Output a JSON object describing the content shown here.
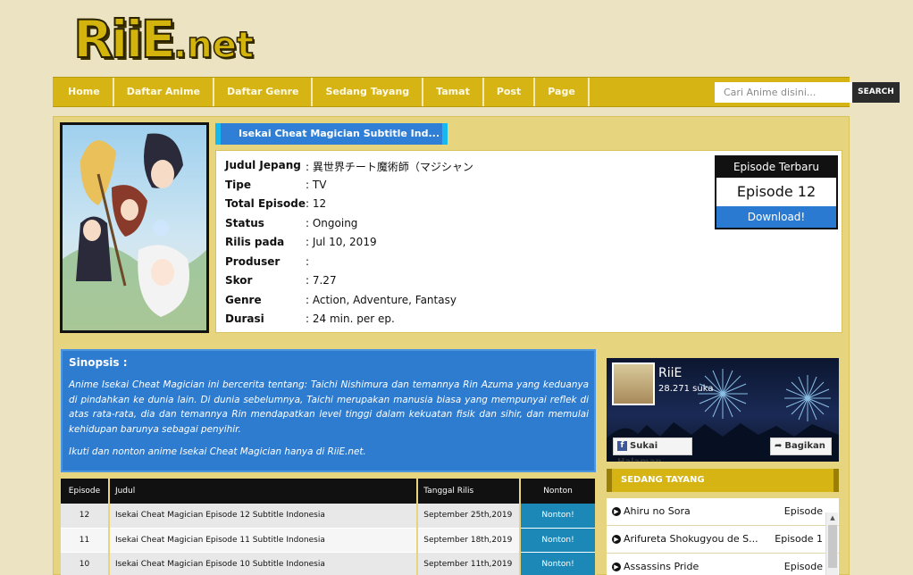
{
  "logo": {
    "main": "RiiE",
    "suffix": ".net"
  },
  "nav": {
    "items": [
      "Home",
      "Daftar Anime",
      "Daftar Genre",
      "Sedang Tayang",
      "Tamat",
      "Post",
      "Page"
    ],
    "search_placeholder": "Cari Anime disini...",
    "search_button": "SEARCH"
  },
  "anime": {
    "title": "Isekai Cheat Magician Subtitle Ind...",
    "info": [
      {
        "label": "Judul Jepang",
        "value": ": 異世界チート魔術師（マジシャン"
      },
      {
        "label": "Tipe",
        "value": ": TV"
      },
      {
        "label": "Total Episode",
        "value": ": 12"
      },
      {
        "label": "Status",
        "value": ": Ongoing"
      },
      {
        "label": "Rilis pada",
        "value": ": Jul 10, 2019"
      },
      {
        "label": "Produser",
        "value": ":"
      },
      {
        "label": "Skor",
        "value": ": 7.27"
      },
      {
        "label": "Genre",
        "value": ": Action, Adventure, Fantasy"
      },
      {
        "label": "Durasi",
        "value": ": 24 min. per ep."
      }
    ]
  },
  "latest_episode": {
    "heading": "Episode Terbaru",
    "episode": "Episode 12",
    "download": "Download!"
  },
  "sinopsis": {
    "title": "Sinopsis :",
    "text": "Anime Isekai Cheat Magician ini bercerita tentang: Taichi Nishimura dan temannya Rin Azuma yang keduanya di pindahkan ke dunia lain. Di dunia sebelumnya, Taichi merupakan manusia biasa yang mempunyai reflek di atas rata-rata, dia dan temannya Rin mendapatkan level tinggi dalam kekuatan fisik dan sihir, dan memulai kehidupan barunya sebagai penyihir.",
    "text2": "Ikuti dan nonton anime Isekai Cheat Magician hanya di RiiE.net."
  },
  "episodes_table": {
    "headers": [
      "Episode",
      "Judul",
      "Tanggal Rilis",
      "Nonton"
    ],
    "rows": [
      {
        "ep": "12",
        "title": "Isekai Cheat Magician Episode 12 Subtitle Indonesia",
        "date": "September 25th,2019",
        "action": "Nonton!"
      },
      {
        "ep": "11",
        "title": "Isekai Cheat Magician Episode 11 Subtitle Indonesia",
        "date": "September 18th,2019",
        "action": "Nonton!"
      },
      {
        "ep": "10",
        "title": "Isekai Cheat Magician Episode 10 Subtitle Indonesia",
        "date": "September 11th,2019",
        "action": "Nonton!"
      }
    ]
  },
  "facebook": {
    "page_name": "RiiE",
    "likes": "28.271 suka",
    "like_button": "Sukai Halaman",
    "share_button": "Bagikan"
  },
  "sidebar": {
    "heading": "SEDANG TAYANG",
    "items": [
      {
        "title": "Ahiru no Sora",
        "ep": "Episode"
      },
      {
        "title": "Arifureta Shokugyou de S...",
        "ep": "Episode 1"
      },
      {
        "title": "Assassins Pride",
        "ep": "Episode"
      }
    ]
  },
  "colors": {
    "background": "#ece3c2",
    "nav": "#d6b414",
    "accent_blue": "#2e7cd0",
    "content": "#e6d57e",
    "nonton_button": "#1b88b8"
  }
}
